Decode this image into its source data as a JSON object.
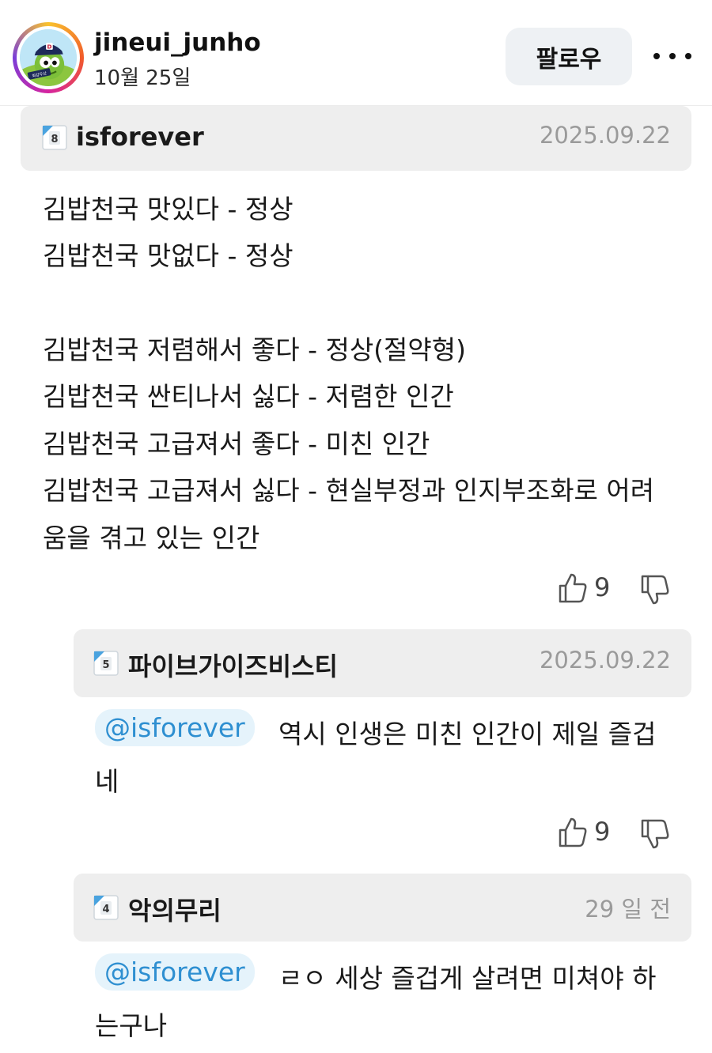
{
  "post": {
    "username": "jineui_junho",
    "date": "10월 25일",
    "follow_label": "팔로우",
    "avatar_badge": "최강두산",
    "avatar_cap_letter": "D"
  },
  "comment": {
    "author": "isforever",
    "level": "8",
    "date": "2025.09.22",
    "lines": [
      "김밥천국 맛있다 - 정상",
      "김밥천국 맛없다 - 정상",
      "김밥천국 저렴해서 좋다 - 정상(절약형)",
      "김밥천국 싼티나서 싫다 - 저렴한 인간",
      "김밥천국 고급져서 좋다 - 미친 인간",
      "김밥천국 고급져서 싫다 - 현실부정과 인지부조화로 어려",
      "움을 겪고 있는 인간"
    ],
    "likes": "9"
  },
  "replies": [
    {
      "author": "파이브가이즈비스티",
      "level": "5",
      "date": "2025.09.22",
      "mention": "@isforever",
      "text_line1": "역시 인생은 미친 인간이 제일 즐겁",
      "text_line2": "네",
      "likes": "9"
    },
    {
      "author": "악의무리",
      "level": "4",
      "date": "29 일 전",
      "mention": "@isforever",
      "text_line1": "ㄹㅇ 세상 즐겁게 살려면 미쳐야 하",
      "text_line2": "는구나"
    }
  ],
  "icons": {
    "more": "more-horizontal-icon",
    "thumb_up": "thumbs-up-icon",
    "thumb_down": "thumbs-down-icon",
    "level": "level-badge-icon"
  },
  "colors": {
    "mention_text": "#2e8fd1",
    "mention_bg": "#e5f3fb",
    "bar_bg": "#eeeeee",
    "date_gray": "#9a9a9a"
  }
}
